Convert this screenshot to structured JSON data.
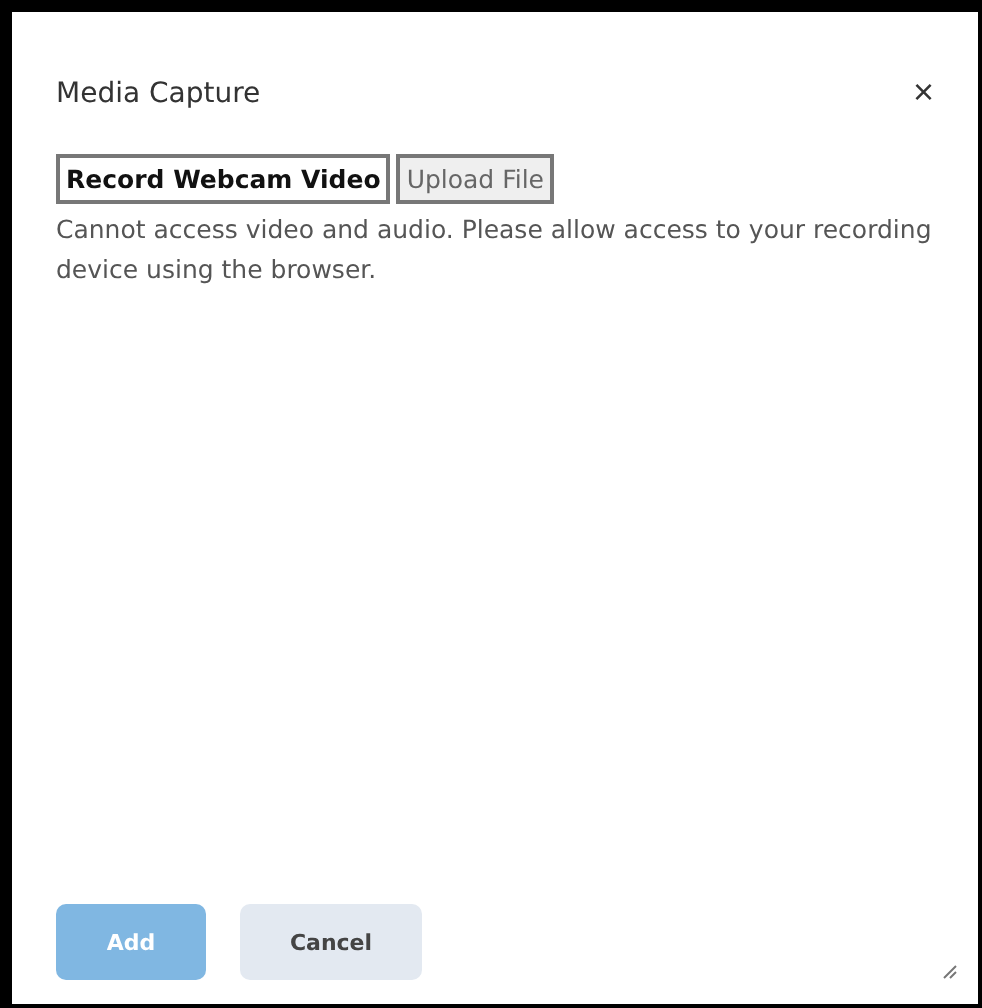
{
  "dialog": {
    "title": "Media Capture",
    "close": "×"
  },
  "tabs": [
    {
      "label": "Record Webcam Video",
      "selected": true
    },
    {
      "label": "Upload File",
      "selected": false
    }
  ],
  "message": "Cannot access video and audio. Please allow access to your recording device using the browser.",
  "buttons": [
    {
      "label": "Add",
      "kind": "primary",
      "disabled": true
    },
    {
      "label": "Cancel",
      "kind": "secondary",
      "disabled": false
    }
  ]
}
